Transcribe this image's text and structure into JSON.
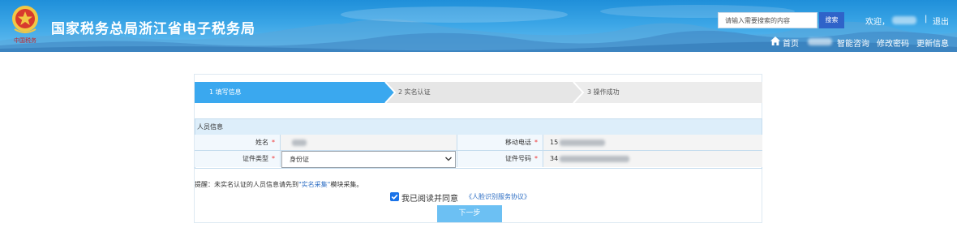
{
  "header": {
    "emblem_text": "中国税务",
    "title": "国家税务总局浙江省电子税务局",
    "search": {
      "placeholder": "请输入需要搜索的内容",
      "button_label": "搜索"
    },
    "welcome": "欢迎，",
    "separator": "|",
    "logout": "退出",
    "nav": {
      "home": "首页",
      "smart_consult": "智能咨询",
      "change_password": "修改密码",
      "update_info": "更新信息"
    }
  },
  "steps": [
    {
      "label": "1  填写信息",
      "state": "active"
    },
    {
      "label": "2  实名认证",
      "state": "pending"
    },
    {
      "label": "3  操作成功",
      "state": "pending"
    }
  ],
  "section": {
    "title": "人员信息"
  },
  "form": {
    "name_label": "姓名",
    "mobile_label": "移动电话",
    "mobile_prefix": "15",
    "id_type_label": "证件类型",
    "id_type_value": "身份证",
    "id_number_label": "证件号码",
    "id_number_prefix": "34",
    "required_mark": "*"
  },
  "reminder": {
    "prefix": "提醒：未实名认证的人员信息请先到",
    "link": "\"实名采集\"",
    "suffix": "模块采集。"
  },
  "agreement": {
    "checked": true,
    "text": "我已阅读并同意",
    "link": "《人脸识别服务协议》"
  },
  "next_button": "下一步",
  "colors": {
    "header_blue": "#1f8fd9",
    "step_active": "#3aa8ef",
    "step_inactive": "#e6e6e6",
    "section_bg": "#ddeefa",
    "link_blue": "#2f6fc4",
    "button_blue": "#6cc0f3",
    "search_button": "#2f63c9",
    "required_red": "#e33333"
  },
  "icons": [
    "emblem-icon",
    "home-icon",
    "chevron-down-icon",
    "checkbox-checked-icon"
  ]
}
